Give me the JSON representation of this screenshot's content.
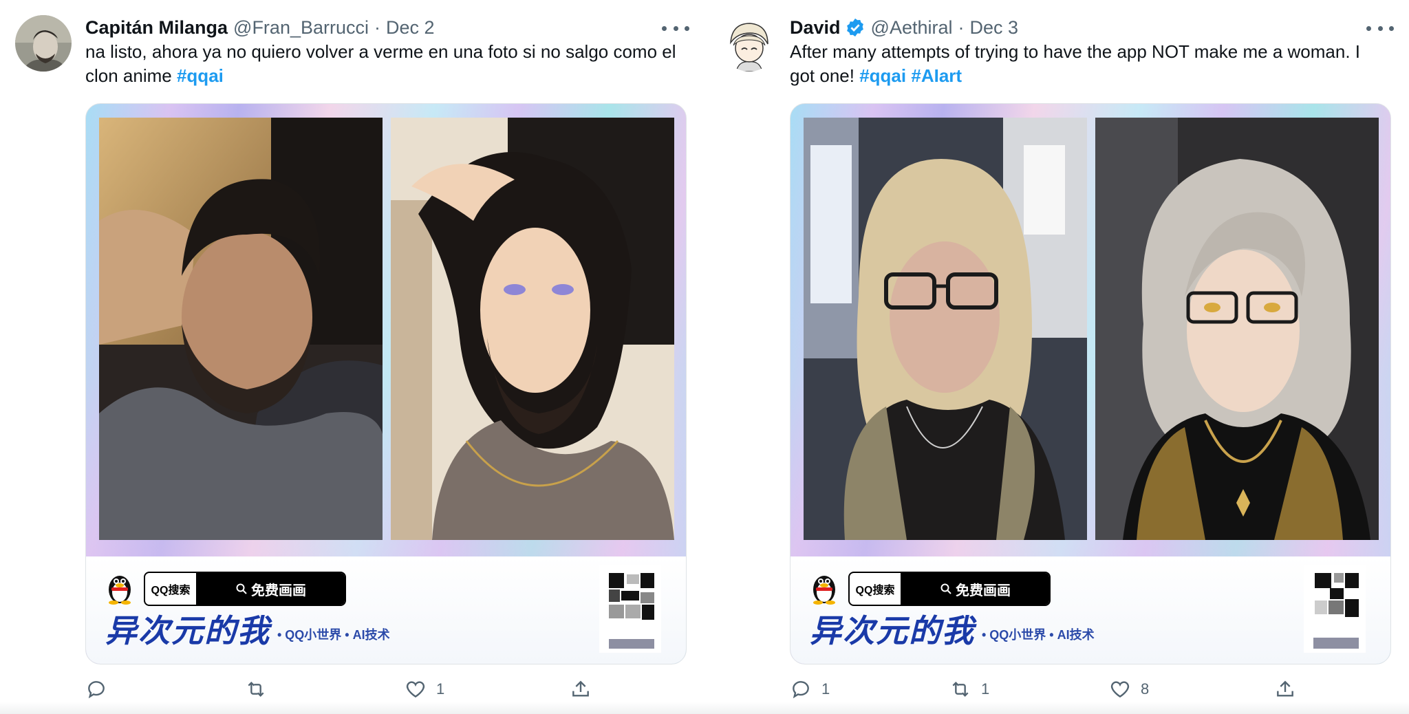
{
  "tweets": [
    {
      "author": {
        "name": "Capitán Milanga",
        "handle": "@Fran_Barrucci",
        "verified": false
      },
      "date": "Dec 2",
      "text": "na listo, ahora ya no quiero volver a verme en una foto si no salgo como el clon anime ",
      "hashtags": [
        "#qqai"
      ],
      "media": {
        "search_label": "QQ搜索",
        "search_button": "免费画画",
        "brand_title": "异次元的我",
        "brand_subtitle": "• QQ小世界 • AI技术"
      },
      "metrics": {
        "replies": "",
        "retweets": "",
        "likes": "1"
      }
    },
    {
      "author": {
        "name": "David",
        "handle": "@Aethiral",
        "verified": true
      },
      "date": "Dec 3",
      "text": "After many attempts of trying to have the app NOT make me a woman. I got one! ",
      "hashtags": [
        "#qqai",
        "#AIart"
      ],
      "media": {
        "search_label": "QQ搜索",
        "search_button": "免费画画",
        "brand_title": "异次元的我",
        "brand_subtitle": "• QQ小世界 • AI技术"
      },
      "metrics": {
        "replies": "1",
        "retweets": "1",
        "likes": "8"
      }
    }
  ],
  "separator": "·",
  "colors": {
    "link": "#1d9bf0",
    "muted": "#536471",
    "verified": "#1d9bf0",
    "brand": "#1a3aa8"
  },
  "icons": [
    "more-icon",
    "reply-icon",
    "retweet-icon",
    "like-icon",
    "share-icon",
    "verified-badge-icon",
    "qq-penguin-icon",
    "search-icon"
  ]
}
